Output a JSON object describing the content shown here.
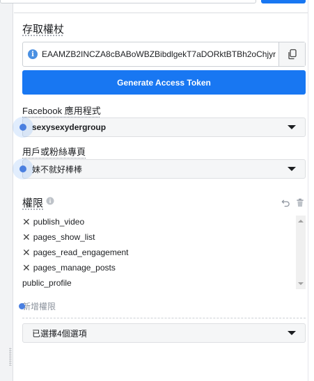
{
  "access_token_section": {
    "title": "存取權杖",
    "token_value": "EAAMZB2INCZA8cBABoWBZBibdlgekT7aDORktBTBh2oChjyr",
    "generate_button_label": "Generate Access Token"
  },
  "facebook_app": {
    "label": "Facebook 應用程式",
    "selected": "sexysexydergroup"
  },
  "user_or_page": {
    "label": "用戶或粉絲專頁",
    "selected": "妹不就好棒棒"
  },
  "permissions": {
    "title": "權限",
    "items": [
      {
        "label": "publish_video",
        "removable": true
      },
      {
        "label": "pages_show_list",
        "removable": true
      },
      {
        "label": "pages_read_engagement",
        "removable": true
      },
      {
        "label": "pages_manage_posts",
        "removable": true
      },
      {
        "label": "public_profile",
        "removable": false
      }
    ],
    "add_placeholder": "新增權限",
    "selection_summary": "已選擇4個選項"
  },
  "icons": {
    "info": "info-icon",
    "copy": "copy-icon",
    "undo": "undo-icon",
    "trash": "trash-icon",
    "caret": "chevron-down-icon",
    "remove": "close-icon"
  },
  "colors": {
    "primary": "#1877f2",
    "field_bg": "#f5f6f7"
  }
}
